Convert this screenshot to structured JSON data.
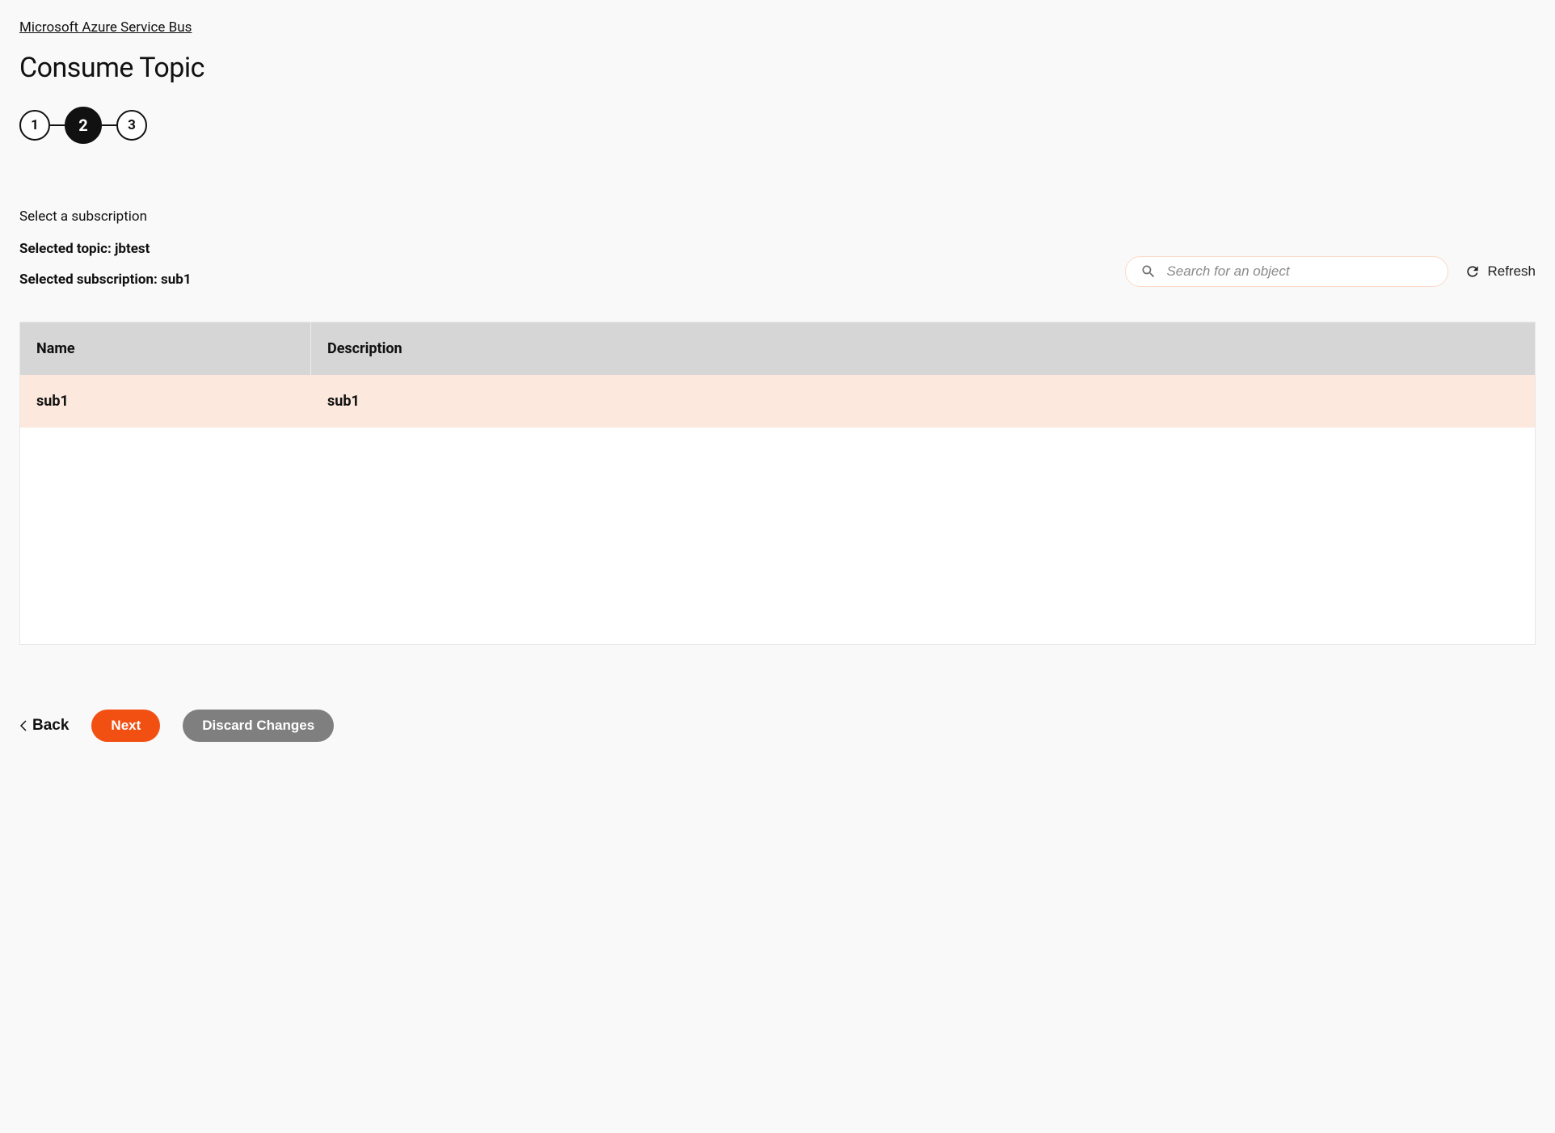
{
  "breadcrumb": "Microsoft Azure Service Bus",
  "page_title": "Consume Topic",
  "stepper": {
    "steps": [
      "1",
      "2",
      "3"
    ],
    "active_index": 1
  },
  "instruction": "Select a subscription",
  "selected_topic_label": "Selected topic: jbtest",
  "selected_subscription_label": "Selected subscription: sub1",
  "search": {
    "placeholder": "Search for an object"
  },
  "refresh_label": "Refresh",
  "table": {
    "headers": {
      "name": "Name",
      "description": "Description"
    },
    "rows": [
      {
        "name": "sub1",
        "description": "sub1",
        "selected": true
      }
    ]
  },
  "footer": {
    "back_label": "Back",
    "next_label": "Next",
    "discard_label": "Discard Changes"
  }
}
